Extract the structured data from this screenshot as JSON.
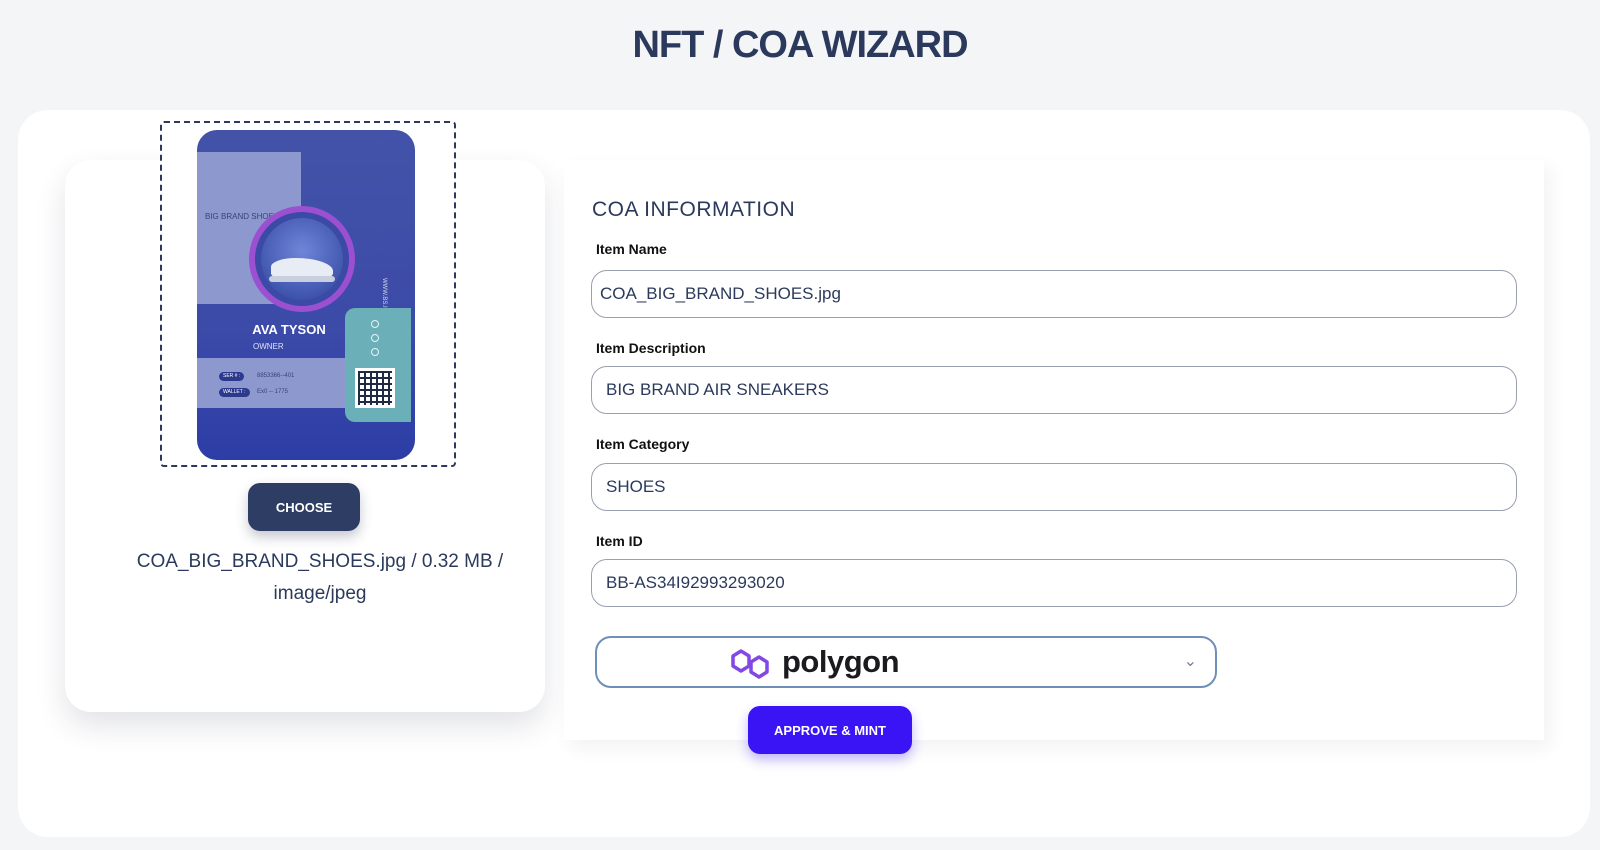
{
  "page": {
    "title": "NFT / COA WIZARD"
  },
  "preview": {
    "brand": "BIG BRAND SHOES",
    "owner_name": "AVA TYSON",
    "owner_role": "OWNER",
    "ser_label": "SER # :",
    "ser_value": "8853366--401",
    "wallet_label": "WALLET :",
    "wallet_value": "Ex0 -- 1775",
    "vertical_text": "WWW.BS.IO"
  },
  "upload": {
    "choose_label": "CHOOSE",
    "file_info": "COA_BIG_BRAND_SHOES.jpg / 0.32 MB / image/jpeg"
  },
  "form": {
    "section_title": "COA INFORMATION",
    "fields": [
      {
        "label": "Item Name",
        "value": "COA_BIG_BRAND_SHOES.jpg"
      },
      {
        "label": "Item Description",
        "value": "BIG BRAND AIR SNEAKERS"
      },
      {
        "label": "Item Category",
        "value": "SHOES"
      },
      {
        "label": "Item ID",
        "value": "BB-AS34I92993293020"
      }
    ],
    "network": {
      "selected": "polygon",
      "icon": "polygon-logo-icon",
      "logo_color": "#8247e5"
    },
    "submit_label": "APPROVE & MINT"
  },
  "colors": {
    "primary_dark": "#2e3d63",
    "accent": "#3b14f5",
    "background": "#f4f5f7"
  }
}
